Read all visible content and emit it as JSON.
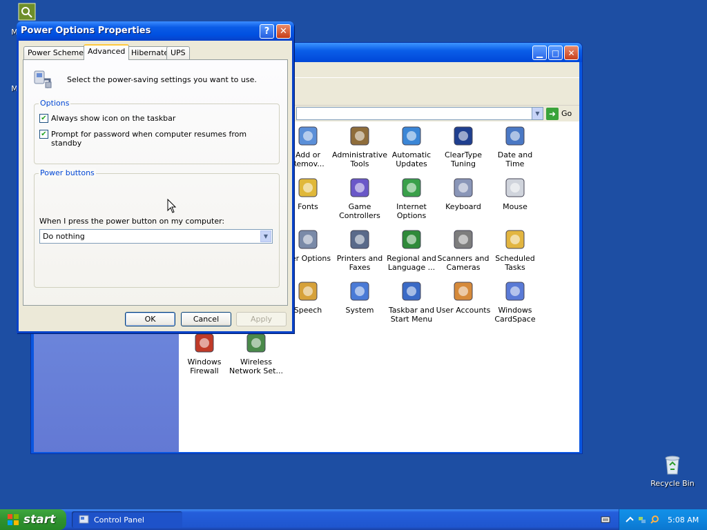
{
  "desktop": {
    "top_icon_letter": "",
    "recycle_bin_label": "Recycle Bin"
  },
  "control_panel": {
    "go_label": "Go",
    "items": [
      {
        "name": "add-remove",
        "label": "Add or Remov..."
      },
      {
        "name": "administrative-tools",
        "label": "Administrative Tools"
      },
      {
        "name": "automatic-updates",
        "label": "Automatic Updates"
      },
      {
        "name": "cleartype-tuning",
        "label": "ClearType Tuning"
      },
      {
        "name": "date-and-time",
        "label": "Date and Time"
      },
      {
        "name": "fonts",
        "label": "Fonts"
      },
      {
        "name": "game-controllers",
        "label": "Game Controllers"
      },
      {
        "name": "internet-options",
        "label": "Internet Options"
      },
      {
        "name": "keyboard",
        "label": "Keyboard"
      },
      {
        "name": "mouse",
        "label": "Mouse"
      },
      {
        "name": "power-options",
        "label": "wer Options"
      },
      {
        "name": "printers-and-faxes",
        "label": "Printers and Faxes"
      },
      {
        "name": "regional-and-language",
        "label": "Regional and Language ..."
      },
      {
        "name": "scanners-and-cameras",
        "label": "Scanners and Cameras"
      },
      {
        "name": "scheduled-tasks",
        "label": "Scheduled Tasks"
      },
      {
        "name": "speech",
        "label": "Speech"
      },
      {
        "name": "system",
        "label": "System"
      },
      {
        "name": "taskbar-and-start-menu",
        "label": "Taskbar and Start Menu"
      },
      {
        "name": "user-accounts",
        "label": "User Accounts"
      },
      {
        "name": "windows-cardspace",
        "label": "Windows CardSpace"
      },
      {
        "name": "windows-firewall",
        "label": "Windows Firewall"
      },
      {
        "name": "wireless-network-setup",
        "label": "Wireless Network Set..."
      }
    ]
  },
  "dialog": {
    "title": "Power Options Properties",
    "help_glyph": "?",
    "close_glyph": "✕",
    "tabs": [
      "Power Schemes",
      "Advanced",
      "Hibernate",
      "UPS"
    ],
    "active_tab": "Advanced",
    "intro": "Select the power-saving settings you want to use.",
    "options_group": "Options",
    "checkbox_taskbar": "Always show icon on the taskbar",
    "checkbox_taskbar_checked": true,
    "checkbox_password": "Prompt for password when computer resumes from standby",
    "checkbox_password_checked": true,
    "power_group": "Power buttons",
    "power_button_label": "When I press the power button on my computer:",
    "power_button_value": "Do nothing",
    "ok": "OK",
    "cancel": "Cancel",
    "apply": "Apply"
  },
  "taskbar": {
    "start": "start",
    "task_control_panel": "Control Panel",
    "clock": "5:08 AM"
  }
}
